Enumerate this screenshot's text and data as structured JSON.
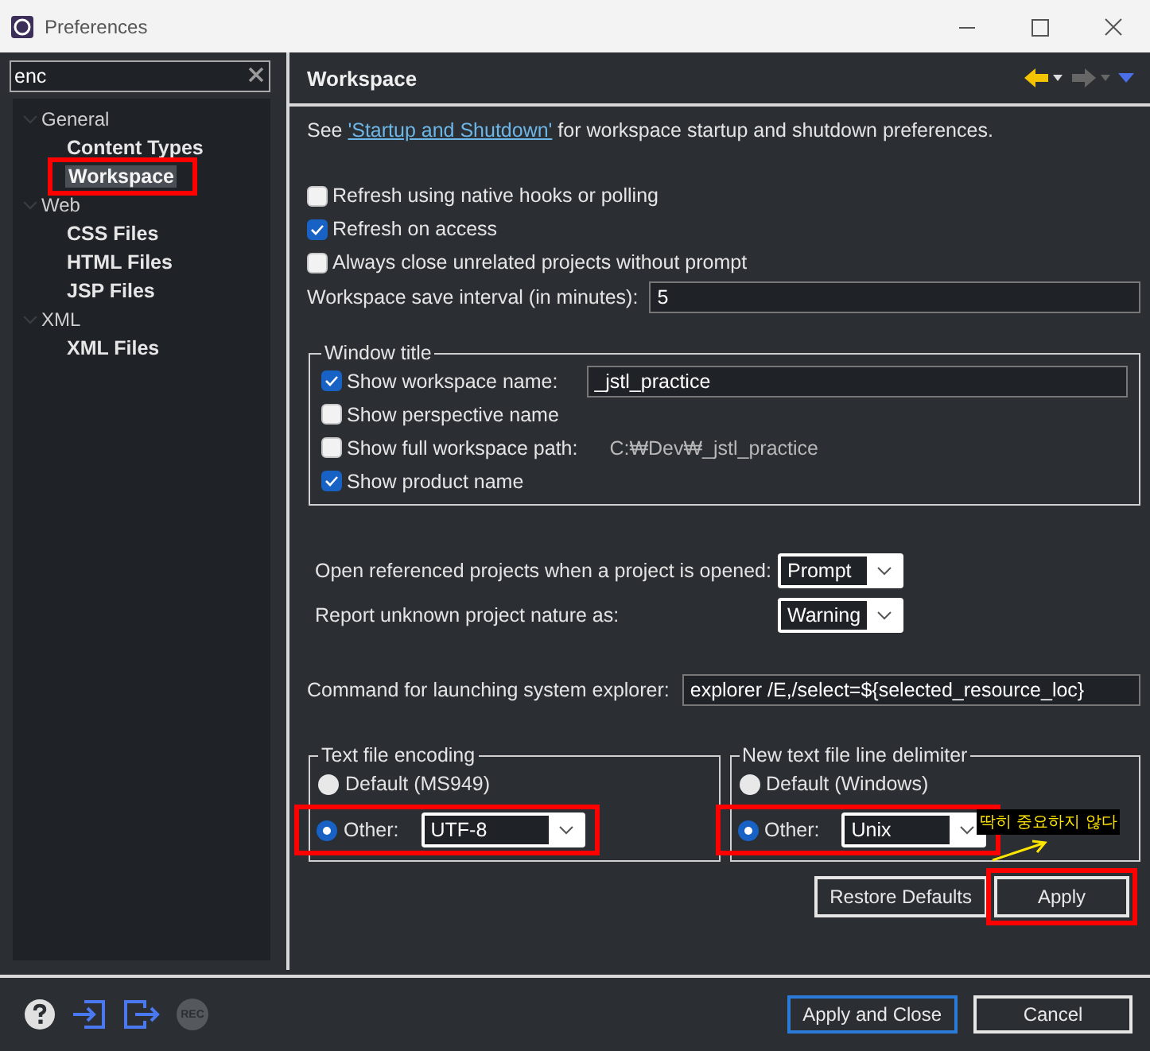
{
  "window": {
    "title": "Preferences"
  },
  "sidebar": {
    "filter": {
      "value": "enc"
    },
    "tree": [
      {
        "label": "General",
        "expanded": true,
        "children": [
          {
            "label": "Content Types",
            "selected": false,
            "annotated": false
          },
          {
            "label": "Workspace",
            "selected": true,
            "annotated": true
          }
        ]
      },
      {
        "label": "Web",
        "expanded": true,
        "children": [
          {
            "label": "CSS Files",
            "selected": false,
            "annotated": false
          },
          {
            "label": "HTML Files",
            "selected": false,
            "annotated": false
          },
          {
            "label": "JSP Files",
            "selected": false,
            "annotated": false
          }
        ]
      },
      {
        "label": "XML",
        "expanded": true,
        "children": [
          {
            "label": "XML Files",
            "selected": false,
            "annotated": false
          }
        ]
      }
    ]
  },
  "page": {
    "title": "Workspace",
    "intro": {
      "before": "See ",
      "link": "'Startup and Shutdown'",
      "after": " for workspace startup and shutdown preferences."
    },
    "checkboxes": [
      {
        "label": "Refresh using native hooks or polling",
        "checked": false
      },
      {
        "label": "Refresh on access",
        "checked": true
      },
      {
        "label": "Always close unrelated projects without prompt",
        "checked": false
      }
    ],
    "save_interval": {
      "label": "Workspace save interval (in minutes):",
      "value": "5"
    },
    "window_title": {
      "legend": "Window title",
      "items": [
        {
          "kind": "field",
          "label": "Show workspace name:",
          "checked": true,
          "value": "_jstl_practice"
        },
        {
          "kind": "plain",
          "label": "Show perspective name",
          "checked": false
        },
        {
          "kind": "path",
          "label": "Show full workspace path:",
          "checked": false,
          "path": "C:₩Dev₩_jstl_practice"
        },
        {
          "kind": "plain",
          "label": "Show product name",
          "checked": true
        }
      ]
    },
    "combos": [
      {
        "label": "Open referenced projects when a project is opened:",
        "value": "Prompt"
      },
      {
        "label": "Report unknown project nature as:",
        "value": "Warning"
      }
    ],
    "command": {
      "label": "Command for launching system explorer:",
      "value": "explorer /E,/select=${selected_resource_loc}"
    },
    "groups": [
      {
        "legend": "Text file encoding",
        "options": [
          {
            "label": "Default (MS949)",
            "selected": false
          },
          {
            "label": "Other:",
            "selected": true,
            "value": "UTF-8",
            "annotated": true
          }
        ]
      },
      {
        "legend": "New text file line delimiter",
        "options": [
          {
            "label": "Default (Windows)",
            "selected": false
          },
          {
            "label": "Other:",
            "selected": true,
            "value": "Unix",
            "annotated": true
          }
        ]
      }
    ],
    "buttons": [
      {
        "label": "Restore Defaults",
        "annotated": false
      },
      {
        "label": "Apply",
        "annotated": true
      }
    ],
    "note": "딱히 중요하지 않다"
  },
  "footer": {
    "rec": "REC",
    "buttons": [
      {
        "label": "Apply and Close",
        "default": true
      },
      {
        "label": "Cancel",
        "default": false
      }
    ]
  }
}
